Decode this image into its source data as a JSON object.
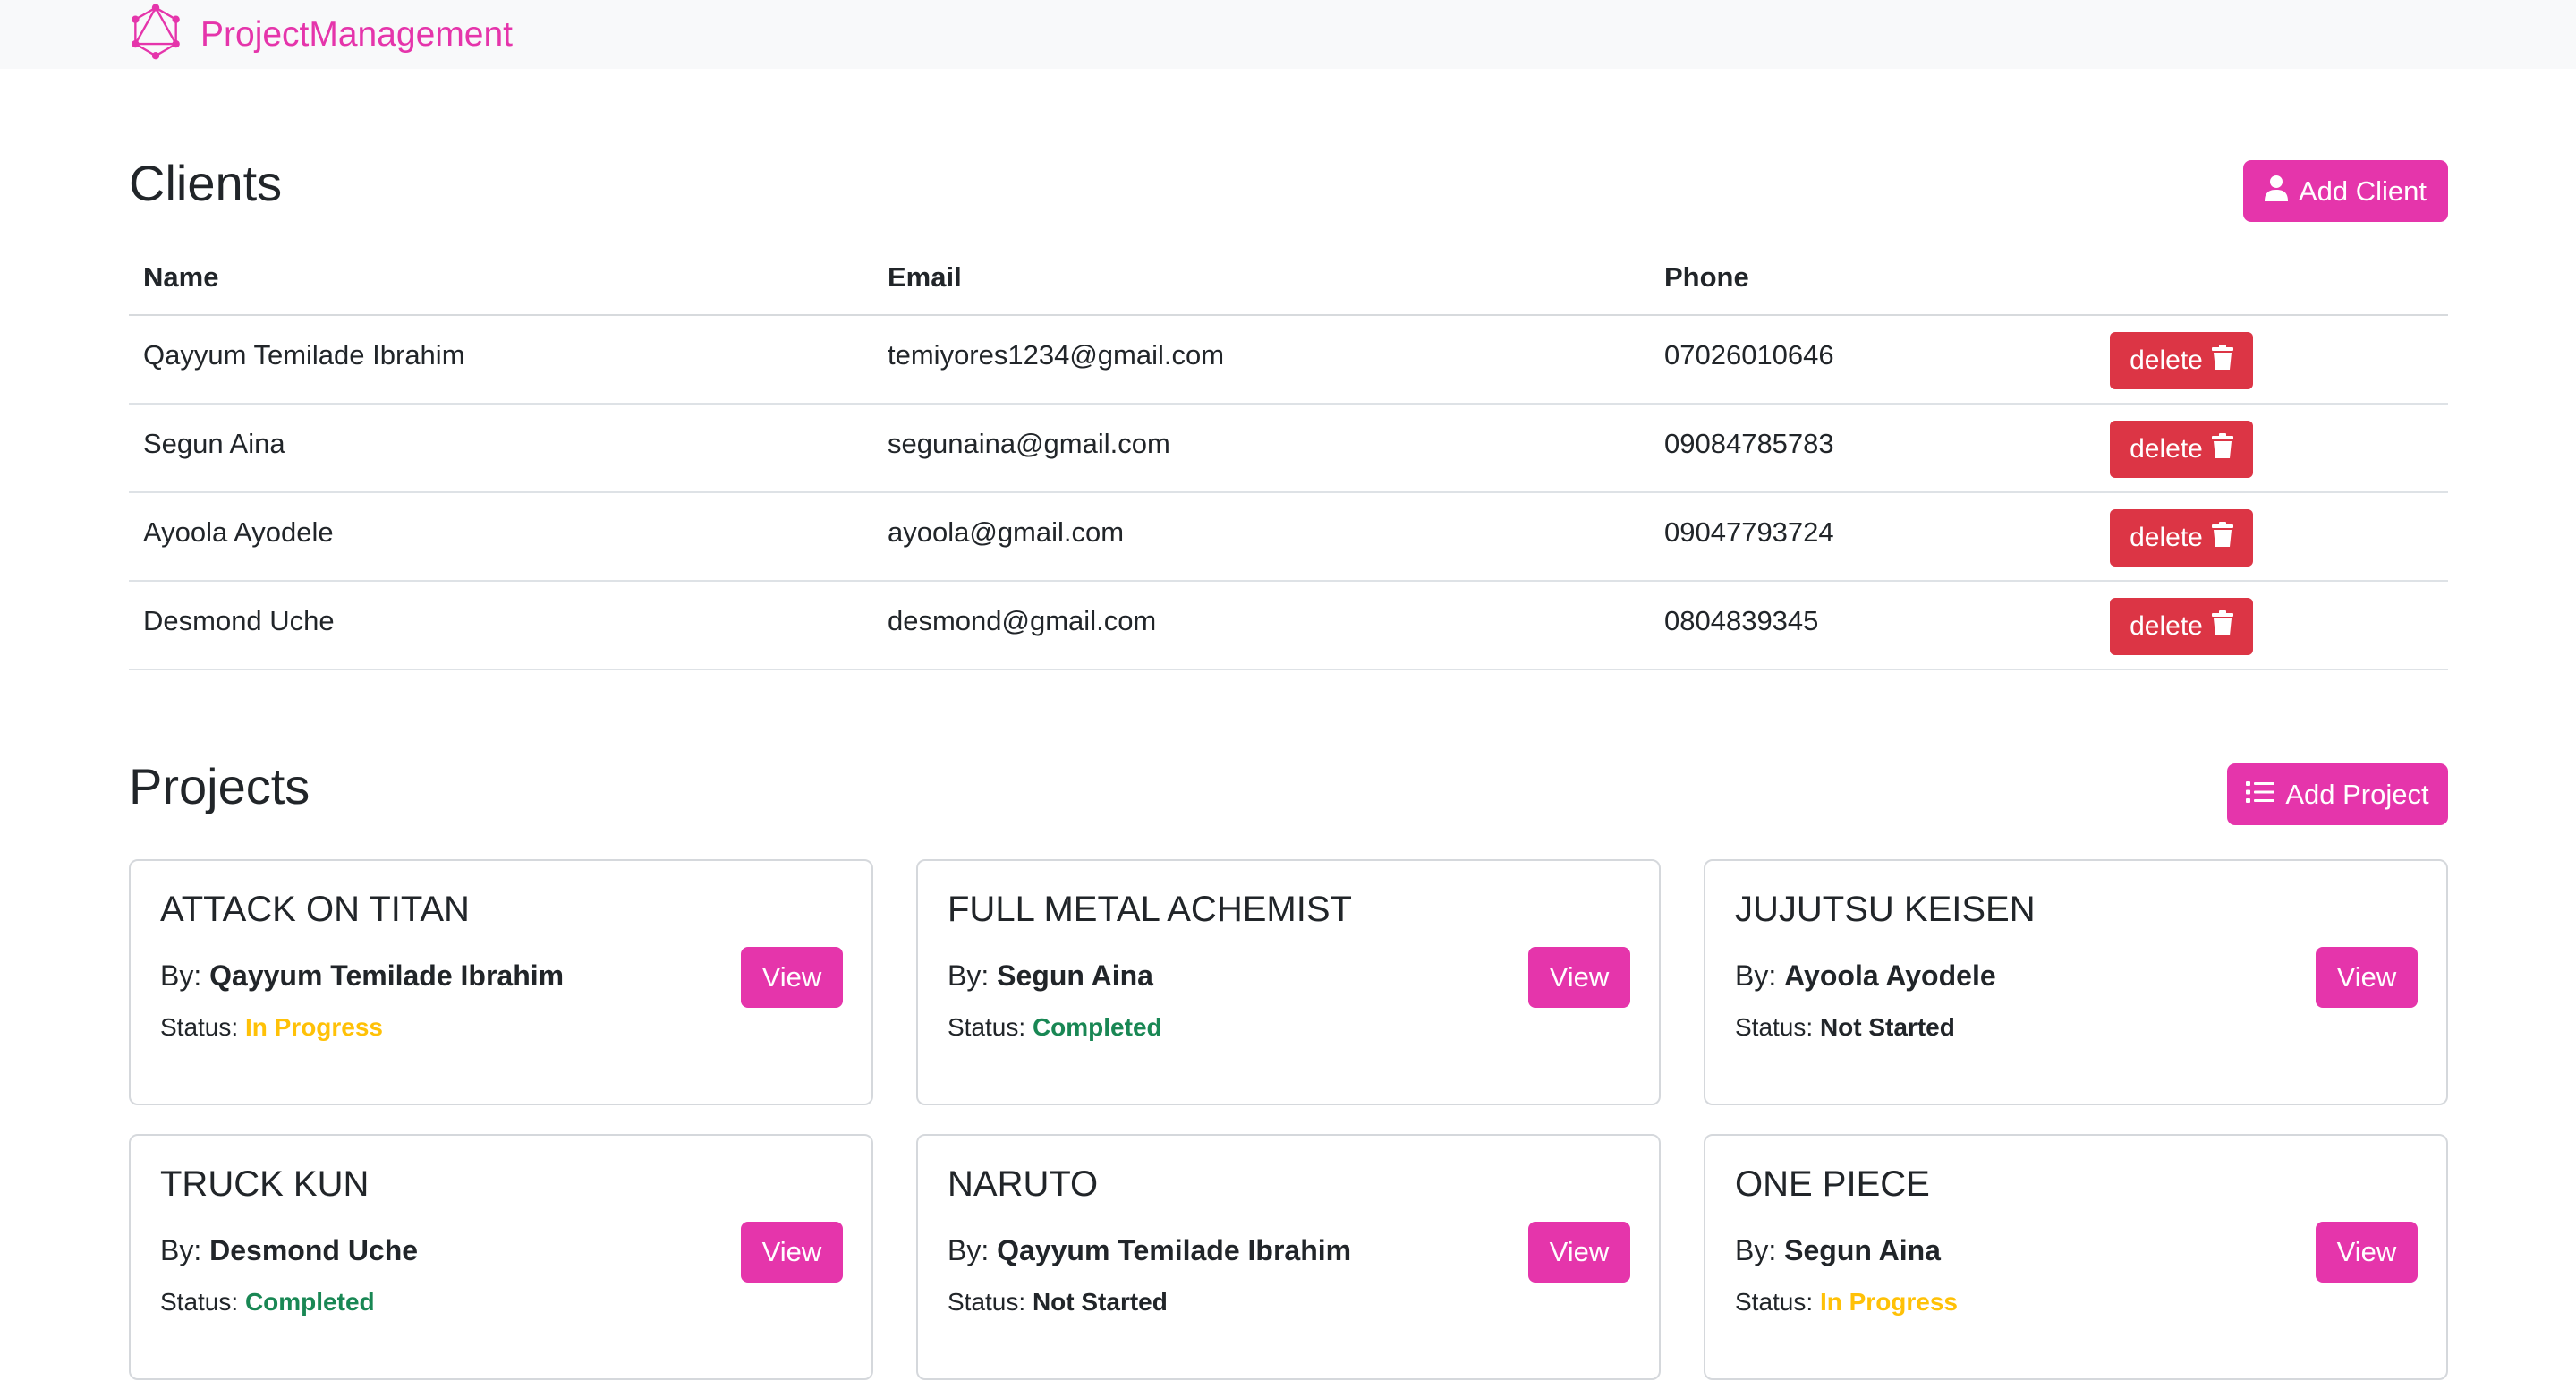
{
  "nav": {
    "brand": "ProjectManagement",
    "logo_icon": "graphql-logo-icon",
    "brand_color": "#e535ab"
  },
  "clients": {
    "title": "Clients",
    "add_label": "Add Client",
    "add_icon": "user-icon",
    "columns": [
      "Name",
      "Email",
      "Phone"
    ],
    "delete_label": "delete",
    "delete_icon": "trash-icon",
    "rows": [
      {
        "name": "Qayyum Temilade Ibrahim",
        "email": "temiyores1234@gmail.com",
        "phone": "07026010646"
      },
      {
        "name": "Segun Aina",
        "email": "segunaina@gmail.com",
        "phone": "09084785783"
      },
      {
        "name": "Ayoola Ayodele",
        "email": "ayoola@gmail.com",
        "phone": "09047793724"
      },
      {
        "name": "Desmond Uche",
        "email": "desmond@gmail.com",
        "phone": "0804839345"
      }
    ]
  },
  "projects": {
    "title": "Projects",
    "add_label": "Add Project",
    "add_icon": "list-icon",
    "by_label": "By:",
    "status_label": "Status:",
    "view_label": "View",
    "status_colors": {
      "In Progress": "#ffc107",
      "Completed": "#198754",
      "Not Started": "#212529"
    },
    "items": [
      {
        "name": "ATTACK ON TITAN",
        "client": "Qayyum Temilade Ibrahim",
        "status": "In Progress"
      },
      {
        "name": "FULL METAL ACHEMIST",
        "client": "Segun Aina",
        "status": "Completed"
      },
      {
        "name": "JUJUTSU KEISEN",
        "client": "Ayoola Ayodele",
        "status": "Not Started"
      },
      {
        "name": "TRUCK KUN",
        "client": "Desmond Uche",
        "status": "Completed"
      },
      {
        "name": "NARUTO",
        "client": "Qayyum Temilade Ibrahim",
        "status": "Not Started"
      },
      {
        "name": "ONE PIECE",
        "client": "Segun Aina",
        "status": "In Progress"
      }
    ]
  }
}
